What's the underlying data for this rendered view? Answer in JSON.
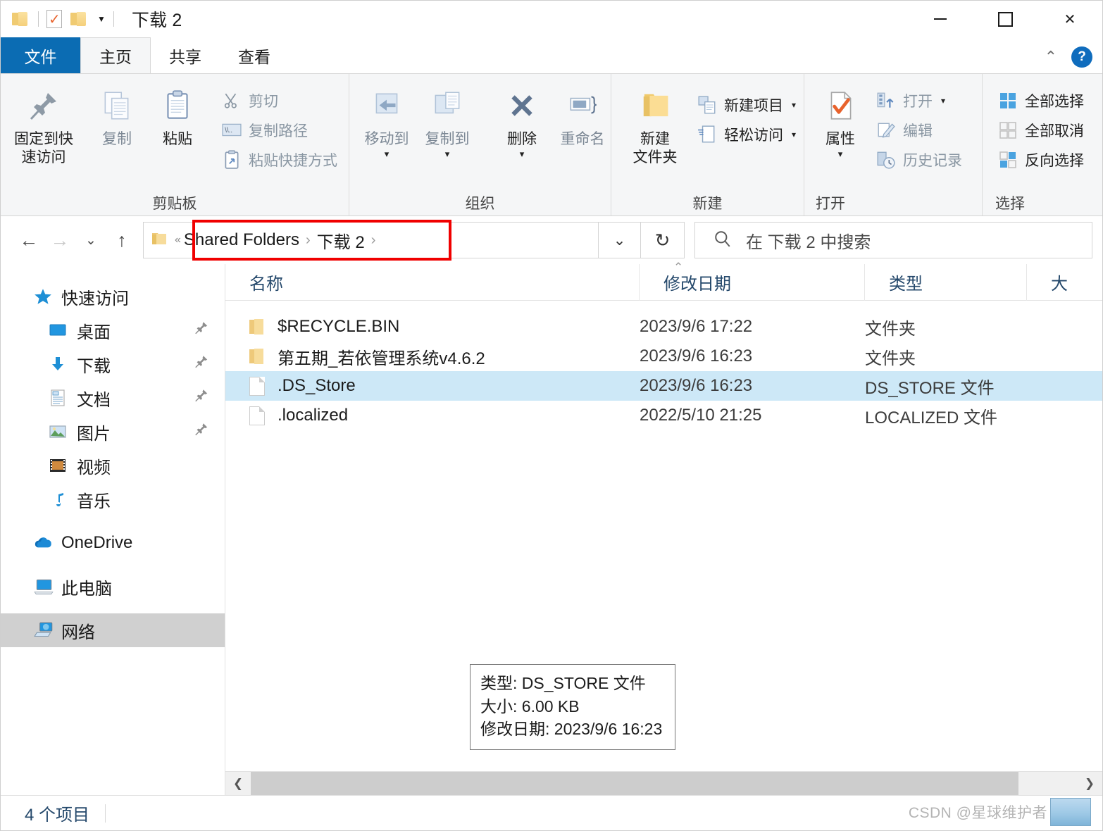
{
  "window": {
    "title": "下载 2",
    "quick_access": [
      {
        "name": "folder-icon",
        "label": ""
      },
      {
        "name": "properties-check-icon",
        "label": ""
      },
      {
        "name": "new-folder-icon",
        "label": ""
      },
      {
        "name": "customize-caret-icon",
        "label": "▼"
      }
    ],
    "controls": {
      "minimize": "—",
      "maximize": "▢",
      "close": "✕"
    }
  },
  "tabs": [
    {
      "label": "文件",
      "id": "file",
      "active": false
    },
    {
      "label": "主页",
      "id": "home",
      "active": true
    },
    {
      "label": "共享",
      "id": "share",
      "active": false
    },
    {
      "label": "查看",
      "id": "view",
      "active": false
    }
  ],
  "tabstrip_right": {
    "collapse": "⌃",
    "help": "?"
  },
  "ribbon": {
    "groups": [
      {
        "title": "剪贴板",
        "big": [
          {
            "label": "固定到快\n速访问",
            "icon": "pin-icon",
            "dim": false
          },
          {
            "label": "复制",
            "icon": "copy-icon",
            "dim": true
          },
          {
            "label": "粘贴",
            "icon": "paste-icon",
            "dim": false
          }
        ],
        "small": [
          {
            "label": "剪切",
            "icon": "scissors-icon",
            "dim": true
          },
          {
            "label": "复制路径",
            "icon": "copy-path-icon",
            "dim": true
          },
          {
            "label": "粘贴快捷方式",
            "icon": "paste-shortcut-icon",
            "dim": true
          }
        ]
      },
      {
        "title": "组织",
        "big": [
          {
            "label": "移动到",
            "icon": "move-to-icon",
            "dim": true,
            "caret": "▾"
          },
          {
            "label": "复制到",
            "icon": "copy-to-icon",
            "dim": true,
            "caret": "▾"
          },
          {
            "label": "删除",
            "icon": "delete-icon",
            "dim": false,
            "caret": "▾"
          },
          {
            "label": "重命名",
            "icon": "rename-icon",
            "dim": true
          }
        ],
        "small": []
      },
      {
        "title": "新建",
        "big": [
          {
            "label": "新建\n文件夹",
            "icon": "new-folder-icon",
            "dim": false
          }
        ],
        "small": [
          {
            "label": "新建项目",
            "icon": "new-item-icon",
            "dim": false,
            "caret": "▾"
          },
          {
            "label": "轻松访问",
            "icon": "easy-access-icon",
            "dim": false,
            "caret": "▾"
          }
        ]
      },
      {
        "title": "打开",
        "big": [
          {
            "label": "属性",
            "icon": "properties-icon",
            "dim": false,
            "caret": "▾"
          }
        ],
        "small": [
          {
            "label": "打开",
            "icon": "open-icon",
            "dim": true,
            "caret": "▾"
          },
          {
            "label": "编辑",
            "icon": "edit-icon",
            "dim": true
          },
          {
            "label": "历史记录",
            "icon": "history-icon",
            "dim": true
          }
        ]
      },
      {
        "title": "选择",
        "big": [],
        "small": [
          {
            "label": "全部选择",
            "icon": "select-all-icon",
            "dim": false
          },
          {
            "label": "全部取消",
            "icon": "select-none-icon",
            "dim": false
          },
          {
            "label": "反向选择",
            "icon": "invert-selection-icon",
            "dim": false
          }
        ]
      }
    ]
  },
  "addressbar": {
    "back": "←",
    "forward": "→",
    "recent": "⌄",
    "up": "↑",
    "breadcrumb_overflow": "«",
    "breadcrumbs": [
      "Shared Folders",
      "下载 2"
    ],
    "breadcrumb_sep": "›",
    "dropdown": "⌄",
    "refresh": "↻",
    "highlight_color": "#f00000"
  },
  "search": {
    "icon": "search-icon",
    "placeholder": "在 下载 2 中搜索"
  },
  "navpane": {
    "items": [
      {
        "label": "快速访问",
        "icon": "quick-access-star-icon",
        "level": 1,
        "pinned": false,
        "selected": false
      },
      {
        "label": "桌面",
        "icon": "desktop-icon",
        "level": 2,
        "pinned": true,
        "selected": false
      },
      {
        "label": "下载",
        "icon": "downloads-icon",
        "level": 2,
        "pinned": true,
        "selected": false
      },
      {
        "label": "文档",
        "icon": "documents-icon",
        "level": 2,
        "pinned": true,
        "selected": false
      },
      {
        "label": "图片",
        "icon": "pictures-icon",
        "level": 2,
        "pinned": true,
        "selected": false
      },
      {
        "label": "视频",
        "icon": "videos-icon",
        "level": 2,
        "pinned": false,
        "selected": false
      },
      {
        "label": "音乐",
        "icon": "music-icon",
        "level": 2,
        "pinned": false,
        "selected": false
      },
      {
        "label": "OneDrive",
        "icon": "onedrive-cloud-icon",
        "level": 1,
        "pinned": false,
        "selected": false
      },
      {
        "label": "此电脑",
        "icon": "this-pc-icon",
        "level": 1,
        "pinned": false,
        "selected": false
      },
      {
        "label": "网络",
        "icon": "network-icon",
        "level": 1,
        "pinned": false,
        "selected": true
      }
    ]
  },
  "filelist": {
    "columns": [
      "名称",
      "修改日期",
      "类型",
      "大"
    ],
    "rows": [
      {
        "name": "$RECYCLE.BIN",
        "date": "2023/9/6 17:22",
        "type": "文件夹",
        "size": "",
        "icon": "folder-icon",
        "selected": false
      },
      {
        "name": "第五期_若依管理系统v4.6.2",
        "date": "2023/9/6 16:23",
        "type": "文件夹",
        "size": "",
        "icon": "folder-icon",
        "selected": false
      },
      {
        "name": ".DS_Store",
        "date": "2023/9/6 16:23",
        "type": "DS_STORE 文件",
        "size": "",
        "icon": "file-icon",
        "selected": true
      },
      {
        "name": ".localized",
        "date": "2022/5/10 21:25",
        "type": "LOCALIZED 文件",
        "size": "",
        "icon": "file-icon",
        "selected": false
      }
    ]
  },
  "tooltip": {
    "lines": [
      "类型: DS_STORE 文件",
      "大小: 6.00 KB",
      "修改日期: 2023/9/6 16:23"
    ]
  },
  "statusbar": {
    "count": "4 个项目",
    "watermark": "CSDN @星球维护者"
  },
  "scrollbar": {
    "left_arrow": "❮",
    "right_arrow": "❯"
  }
}
